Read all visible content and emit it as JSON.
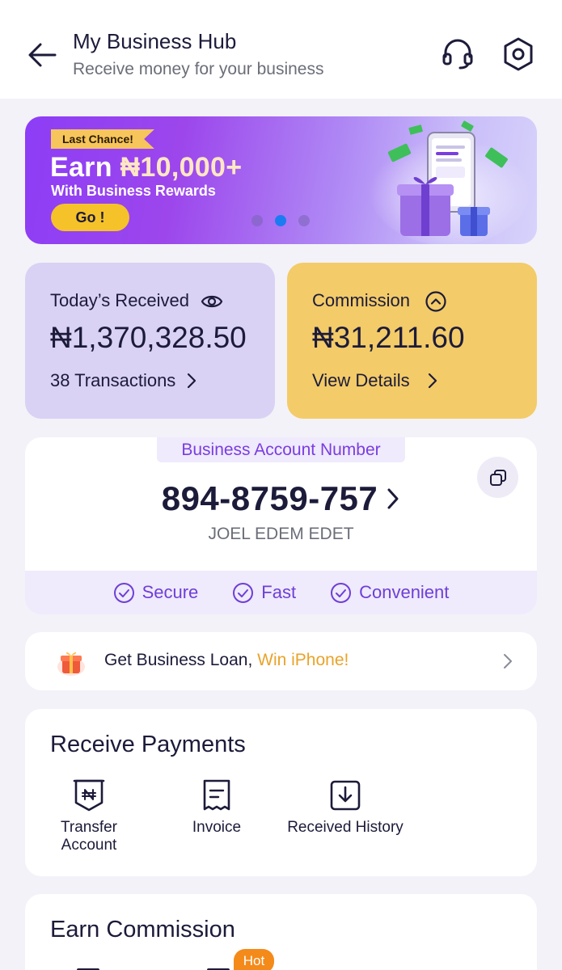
{
  "header": {
    "title": "My Business Hub",
    "subtitle": "Receive money for your business"
  },
  "banner": {
    "tag": "Last Chance!",
    "headline_prefix": "Earn ",
    "headline_amount": "₦10,000+",
    "subline": "With Business Rewards",
    "cta": "Go !",
    "slides_total": 3,
    "active_slide": 2
  },
  "stats": {
    "received": {
      "label": "Today’s Received",
      "amount": "₦1,370,328.50",
      "link": "38 Transactions"
    },
    "commission": {
      "label": "Commission",
      "amount": "₦31,211.60",
      "link": "View Details"
    }
  },
  "account": {
    "tag": "Business Account Number",
    "number": "894-8759-757",
    "name": "JOEL EDEM EDET",
    "features": [
      "Secure",
      "Fast",
      "Convenient"
    ]
  },
  "loan": {
    "text": "Get Business Loan, ",
    "accent": "Win iPhone!"
  },
  "receive_payments": {
    "title": "Receive Payments",
    "actions": [
      {
        "label": "Transfer Account",
        "icon": "naira-receipt-icon"
      },
      {
        "label": "Invoice",
        "icon": "invoice-icon"
      },
      {
        "label": "Received History",
        "icon": "received-history-icon"
      }
    ]
  },
  "earn_commission": {
    "title": "Earn Commission",
    "badge": "Hot"
  },
  "colors": {
    "accent_purple": "#7a3de0",
    "received_card": "#d9d2f4",
    "commission_card": "#f3cb68",
    "cta_yellow": "#f6c22a",
    "loan_accent": "#e9a32a",
    "hot_badge": "#f48a1a",
    "active_dot": "#1b7cf2"
  }
}
